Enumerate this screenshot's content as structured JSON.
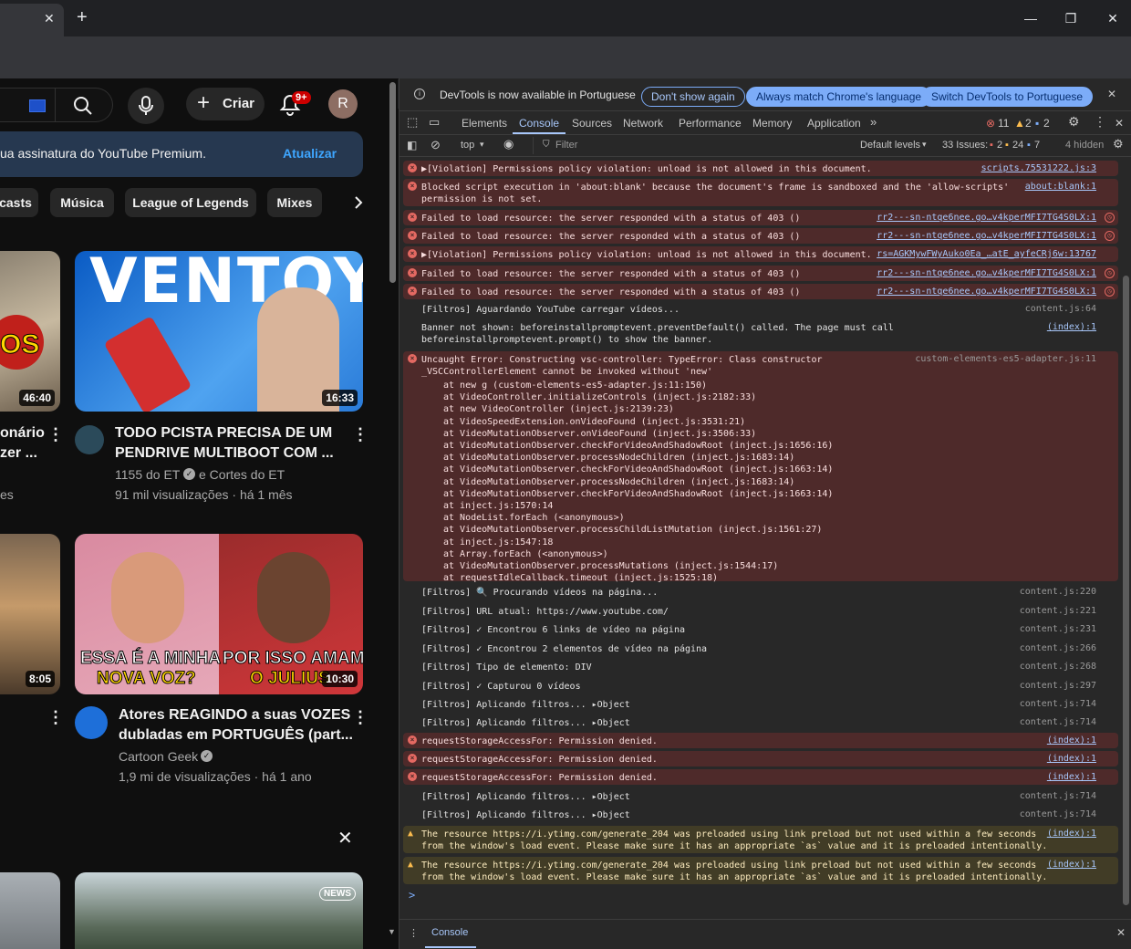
{
  "browser": {
    "new_tab_symbol": "+",
    "close_tab_symbol": "✕",
    "window_controls": [
      "—",
      "❐",
      "✕"
    ],
    "profile_initial": "R"
  },
  "youtube": {
    "create_label": "Criar",
    "notif_badge": "9+",
    "avatar_initial": "R",
    "premium_text": "ua assinatura do YouTube Premium.",
    "update_label": "Atualizar",
    "chips": [
      "casts",
      "Música",
      "League of Legends",
      "Mixes"
    ],
    "videos": [
      {
        "thumb_text": "OS",
        "duration": "46:40",
        "title_1": "onário",
        "title_2": "zer ...",
        "meta": "es"
      },
      {
        "thumb_text": "VENTOY",
        "duration": "16:33",
        "title_1": "TODO PCISTA PRECISA DE UM",
        "title_2": "PENDRIVE MULTIBOOT COM ...",
        "channel": "1155 do ET",
        "channel_extra": "e Cortes do ET",
        "meta": "91 mil visualizações · há 1 mês"
      },
      {
        "duration": "8:05"
      },
      {
        "thumb_left": "ESSA É A MINHA",
        "thumb_left2": "NOVA VOZ?",
        "thumb_right": "POR ISSO AMAM",
        "thumb_right2": "O JULIUS",
        "duration": "10:30",
        "title_1": "Atores REAGINDO a suas VOZES",
        "title_2": "dubladas em PORTUGUÊS (part...",
        "channel": "Cartoon Geek",
        "meta": "1,9 mi de visualizações · há 1 ano"
      },
      {},
      {
        "badge": "NEWS"
      }
    ],
    "close_symbol": "✕"
  },
  "devtools": {
    "infobar_text": "DevTools is now available in Portuguese",
    "btn_dont_show": "Don't show again",
    "btn_match": "Always match Chrome's language",
    "btn_switch": "Switch DevTools to Portuguese",
    "tabs": [
      "Elements",
      "Console",
      "Sources",
      "Network",
      "Performance",
      "Memory",
      "Application"
    ],
    "counts": {
      "errors": "11",
      "warnings": "2",
      "info": "2"
    },
    "filter": {
      "context": "top",
      "placeholder": "Filter",
      "levels": "Default levels",
      "issues_label": "33 Issues:",
      "issues_err": "2",
      "issues_warn": "24",
      "issues_info": "7",
      "hidden": "4 hidden"
    },
    "drawer_tab": "Console",
    "prompt": ">",
    "rows": [
      {
        "type": "err",
        "text": "▶[Violation] Permissions policy violation: unload is not allowed in this document.",
        "src": "scripts.75531222.js:3"
      },
      {
        "type": "err",
        "text": "Blocked script execution in 'about:blank' because the document's frame is sandboxed and the 'allow-scripts'\npermission is not set.",
        "src": "about:blank:1"
      },
      {
        "type": "err",
        "text": "Failed to load resource: the server responded with a status of 403 ()",
        "src": "rr2---sn-ntqe6nee.go…v4kperMFI7TG4S0LX:1"
      },
      {
        "type": "err",
        "text": "Failed to load resource: the server responded with a status of 403 ()",
        "src": "rr2---sn-ntqe6nee.go…v4kperMFI7TG4S0LX:1"
      },
      {
        "type": "err",
        "text": "▶[Violation] Permissions policy violation: unload is not allowed in this document.",
        "src": "rs=AGKMywFWyAuko0Ea_…atE_ayfeCRj6w:13767"
      },
      {
        "type": "err",
        "text": "Failed to load resource: the server responded with a status of 403 ()",
        "src": "rr2---sn-ntqe6nee.go…v4kperMFI7TG4S0LX:1"
      },
      {
        "type": "err",
        "text": "Failed to load resource: the server responded with a status of 403 ()",
        "src": "rr2---sn-ntqe6nee.go…v4kperMFI7TG4S0LX:1"
      },
      {
        "type": "log",
        "text": "[Filtros] Aguardando YouTube carregar vídeos...",
        "src": "content.js:64"
      },
      {
        "type": "log",
        "text": "Banner not shown: beforeinstallpromptevent.preventDefault() called. The page must call\nbeforeinstallpromptevent.prompt() to show the banner.",
        "src": "(index):1"
      },
      {
        "type": "err",
        "text": "Uncaught Error: Constructing vsc-controller: TypeError: Class constructor\n_VSCControllerElement cannot be invoked without 'new'",
        "src": "custom-elements-es5-adapter.js:11"
      },
      {
        "type": "log",
        "text": "[Filtros] 🔍 Procurando vídeos na página...",
        "src": "content.js:220"
      },
      {
        "type": "log",
        "text": "[Filtros] URL atual: https://www.youtube.com/",
        "src": "content.js:221"
      },
      {
        "type": "log",
        "text": "[Filtros] ✓ Encontrou 6 links de vídeo na página",
        "src": "content.js:231"
      },
      {
        "type": "log",
        "text": "[Filtros] ✓ Encontrou 2 elementos de vídeo na página",
        "src": "content.js:266"
      },
      {
        "type": "log",
        "text": "[Filtros] Tipo de elemento: DIV",
        "src": "content.js:268"
      },
      {
        "type": "log",
        "text": "[Filtros] ✓ Capturou 0 vídeos",
        "src": "content.js:297"
      },
      {
        "type": "log",
        "text": "[Filtros] Aplicando filtros... ▸Object",
        "src": "content.js:714"
      },
      {
        "type": "log",
        "text": "[Filtros] Aplicando filtros... ▸Object",
        "src": "content.js:714"
      },
      {
        "type": "err",
        "text": "requestStorageAccessFor: Permission denied.",
        "src": "(index):1"
      },
      {
        "type": "err",
        "text": "requestStorageAccessFor: Permission denied.",
        "src": "(index):1"
      },
      {
        "type": "err",
        "text": "requestStorageAccessFor: Permission denied.",
        "src": "(index):1"
      },
      {
        "type": "log",
        "text": "[Filtros] Aplicando filtros... ▸Object",
        "src": "content.js:714"
      },
      {
        "type": "log",
        "text": "[Filtros] Aplicando filtros... ▸Object",
        "src": "content.js:714"
      },
      {
        "type": "warn",
        "text": "The resource https://i.ytimg.com/generate_204 was preloaded using link preload but not used within a few seconds\nfrom the window's load event. Please make sure it has an appropriate `as` value and it is preloaded intentionally.",
        "src": "(index):1"
      },
      {
        "type": "warn",
        "text": "The resource https://i.ytimg.com/generate_204 was preloaded using link preload but not used within a few seconds\nfrom the window's load event. Please make sure it has an appropriate `as` value and it is preloaded intentionally.",
        "src": "(index):1"
      }
    ],
    "stack": "at new g (custom-elements-es5-adapter.js:11:150)\nat VideoController.initializeControls (inject.js:2182:33)\nat new VideoController (inject.js:2139:23)\nat VideoSpeedExtension.onVideoFound (inject.js:3531:21)\nat VideoMutationObserver.onVideoFound (inject.js:3506:33)\nat VideoMutationObserver.checkForVideoAndShadowRoot (inject.js:1656:16)\nat VideoMutationObserver.processNodeChildren (inject.js:1683:14)\nat VideoMutationObserver.checkForVideoAndShadowRoot (inject.js:1663:14)\nat VideoMutationObserver.processNodeChildren (inject.js:1683:14)\nat VideoMutationObserver.checkForVideoAndShadowRoot (inject.js:1663:14)\nat inject.js:1570:14\nat NodeList.forEach (<anonymous>)\nat VideoMutationObserver.processChildListMutation (inject.js:1561:27)\nat inject.js:1547:18\nat Array.forEach (<anonymous>)\nat VideoMutationObserver.processMutations (inject.js:1544:17)\nat requestIdleCallback.timeout (inject.js:1525:18)"
  }
}
